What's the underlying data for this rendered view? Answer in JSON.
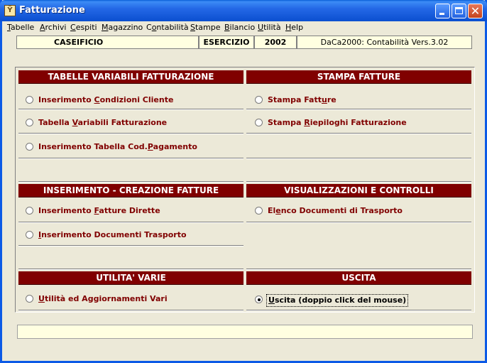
{
  "window": {
    "title": "Fatturazione",
    "icon": "app-icon",
    "icon_glyph": "Ÿ",
    "controls": [
      "minimize-icon",
      "maximize-icon",
      "close-icon"
    ],
    "close_glyph": "✕"
  },
  "menubar": [
    {
      "pre": "",
      "u": "T",
      "post": "abelle"
    },
    {
      "pre": "",
      "u": "A",
      "post": "rchivi"
    },
    {
      "pre": "",
      "u": "C",
      "post": "espiti"
    },
    {
      "pre": "",
      "u": "M",
      "post": "agazzino"
    },
    {
      "pre": "C",
      "u": "o",
      "post": "ntabilità"
    },
    {
      "pre": "",
      "u": "S",
      "post": "tampe"
    },
    {
      "pre": "",
      "u": "B",
      "post": "ilancio"
    },
    {
      "pre": "",
      "u": "U",
      "post": "tilità"
    },
    {
      "pre": "",
      "u": "H",
      "post": "elp"
    }
  ],
  "info": {
    "company": "CASEIFICIO",
    "esercizio_label": "ESERCIZIO",
    "year": "2002",
    "version": "DaCa2000: Contabilità Vers.3.02"
  },
  "sections": {
    "tabelle": {
      "header": "TABELLE VARIABILI FATTURAZIONE",
      "options": [
        {
          "pre": "Inserimento ",
          "u": "C",
          "post": "ondizioni Cliente"
        },
        {
          "pre": "Tabella ",
          "u": "V",
          "post": "ariabili Fatturazione"
        },
        {
          "pre": "Inserimento Tabella Cod.",
          "u": "P",
          "post": "agamento"
        }
      ]
    },
    "stampa": {
      "header": "STAMPA FATTURE",
      "options": [
        {
          "pre": "Stampa Fatt",
          "u": "u",
          "post": "re"
        },
        {
          "pre": "Stampa ",
          "u": "R",
          "post": "iepiloghi Fatturazione"
        }
      ]
    },
    "inserimento": {
      "header": "INSERIMENTO - CREAZIONE FATTURE",
      "options": [
        {
          "pre": "Inserimento ",
          "u": "F",
          "post": "atture Dirette"
        },
        {
          "pre": "",
          "u": "I",
          "post": "nserimento Documenti Trasporto"
        }
      ]
    },
    "visualizzazioni": {
      "header": "VISUALIZZAZIONI E CONTROLLI",
      "options": [
        {
          "pre": "El",
          "u": "e",
          "post": "nco Documenti di Trasporto"
        }
      ]
    },
    "utilita": {
      "header": "UTILITA' VARIE",
      "options": [
        {
          "pre": "",
          "u": "U",
          "post": "tilità ed Aggiornamenti Vari"
        }
      ]
    },
    "uscita": {
      "header": "USCITA",
      "options": [
        {
          "pre": "",
          "u": "U",
          "post": "scita (doppio click del mouse)",
          "checked": true
        }
      ]
    }
  },
  "statusbar": {
    "text": ""
  }
}
